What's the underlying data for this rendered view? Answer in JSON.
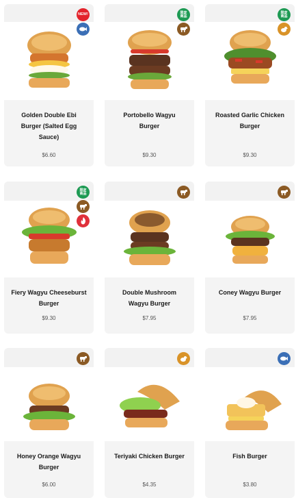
{
  "badges": {
    "new": "NEW!",
    "limited_line1": "限定",
    "limited_line2": "商品"
  },
  "items": [
    {
      "name": "Golden Double Ebi Burger (Salted Egg Sauce)",
      "price": "$6.60",
      "icons": [
        "new",
        "fish-icon"
      ]
    },
    {
      "name": "Portobello Wagyu Burger",
      "price": "$9.30",
      "icons": [
        "limited",
        "beef-icon"
      ]
    },
    {
      "name": "Roasted Garlic Chicken Burger",
      "price": "$9.30",
      "icons": [
        "limited",
        "chicken-icon"
      ]
    },
    {
      "name": "Fiery Wagyu Cheeseburst Burger",
      "price": "$9.30",
      "icons": [
        "limited",
        "beef-icon",
        "spicy-icon"
      ]
    },
    {
      "name": "Double Mushroom Wagyu Burger",
      "price": "$7.95",
      "icons": [
        "beef-icon"
      ]
    },
    {
      "name": "Coney Wagyu Burger",
      "price": "$7.95",
      "icons": [
        "beef-icon"
      ]
    },
    {
      "name": "Honey Orange Wagyu Burger",
      "price": "$6.00",
      "icons": [
        "beef-icon"
      ]
    },
    {
      "name": "Teriyaki Chicken Burger",
      "price": "$4.35",
      "icons": [
        "chicken-icon"
      ]
    },
    {
      "name": "Fish Burger",
      "price": "$3.80",
      "icons": [
        "fish-icon"
      ]
    }
  ],
  "colors": {
    "beef": "#8b5a24",
    "fish": "#3b6fb6",
    "chicken": "#d99328",
    "spicy": "#e0313b",
    "limited": "#1d9a53",
    "new": "#e3232b"
  }
}
